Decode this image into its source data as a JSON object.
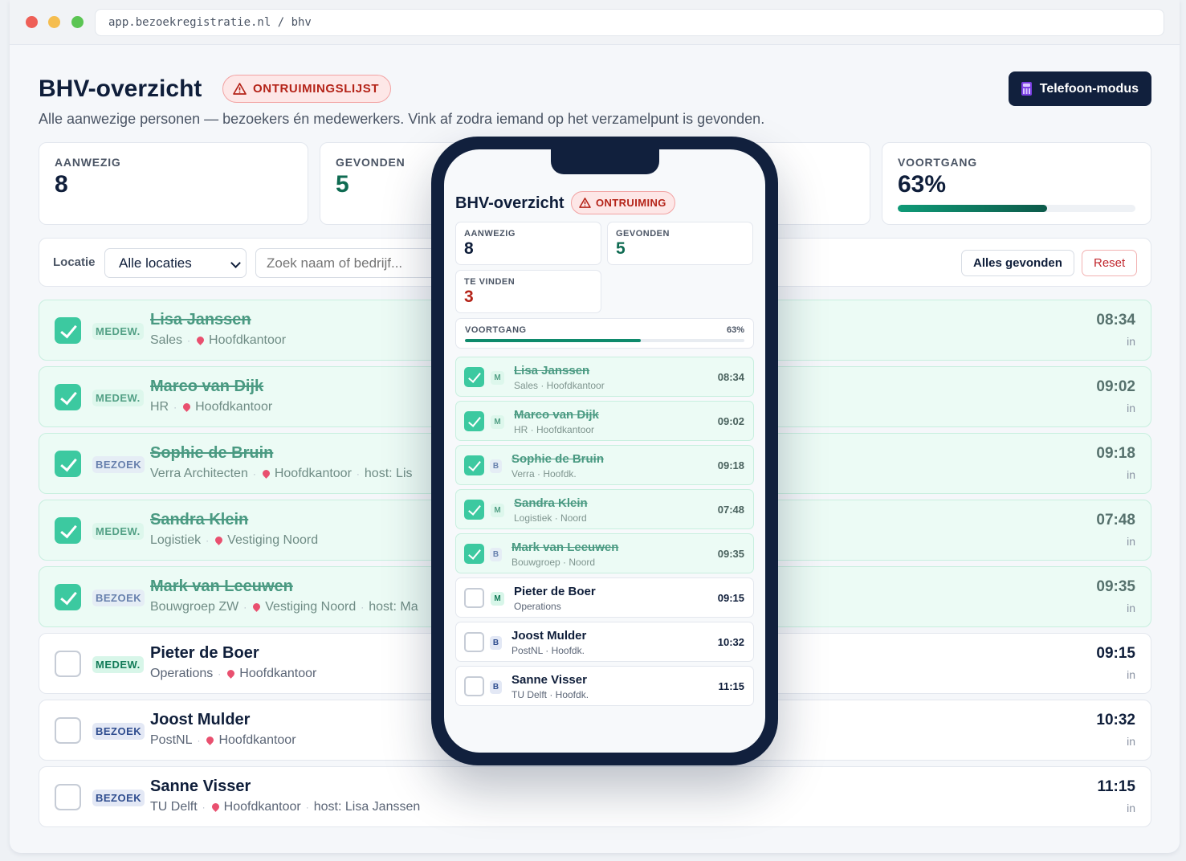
{
  "browser": {
    "url": "app.bezoekregistratie.nl / bhv"
  },
  "header": {
    "title": "BHV-overzicht",
    "badge": "ONTRUIMINGSLIJST",
    "subtitle": "Alle aanwezige personen — bezoekers én medewerkers. Vink af zodra iemand op het verzamelpunt is gevonden.",
    "phone_mode_label": "Telefoon-modus"
  },
  "stats": {
    "present_label": "AANWEZIG",
    "present_value": "8",
    "found_label": "GEVONDEN",
    "found_value": "5",
    "progress_label": "VOORTGANG",
    "progress_value": "63%",
    "progress_fraction": 0.63
  },
  "filters": {
    "location_label": "Locatie",
    "location_selected": "Alle locaties",
    "search_placeholder": "Zoek naam of bedrijf...",
    "all_found_label": "Alles gevonden",
    "reset_label": "Reset"
  },
  "people": [
    {
      "name": "Lisa Janssen",
      "type": "MEDEW.",
      "org": "Sales",
      "location": "Hoofdkantoor",
      "host": "",
      "time": "08:34",
      "dir": "in",
      "found": true
    },
    {
      "name": "Marco van Dijk",
      "type": "MEDEW.",
      "org": "HR",
      "location": "Hoofdkantoor",
      "host": "",
      "time": "09:02",
      "dir": "in",
      "found": true
    },
    {
      "name": "Sophie de Bruin",
      "type": "BEZOEK",
      "org": "Verra Architecten",
      "location": "Hoofdkantoor",
      "host": "host: Lis",
      "time": "09:18",
      "dir": "in",
      "found": true
    },
    {
      "name": "Sandra Klein",
      "type": "MEDEW.",
      "org": "Logistiek",
      "location": "Vestiging Noord",
      "host": "",
      "time": "07:48",
      "dir": "in",
      "found": true
    },
    {
      "name": "Mark van Leeuwen",
      "type": "BEZOEK",
      "org": "Bouwgroep ZW",
      "location": "Vestiging Noord",
      "host": "host: Ma",
      "time": "09:35",
      "dir": "in",
      "found": true
    },
    {
      "name": "Pieter de Boer",
      "type": "MEDEW.",
      "org": "Operations",
      "location": "Hoofdkantoor",
      "host": "",
      "time": "09:15",
      "dir": "in",
      "found": false
    },
    {
      "name": "Joost Mulder",
      "type": "BEZOEK",
      "org": "PostNL",
      "location": "Hoofdkantoor",
      "host": "",
      "time": "10:32",
      "dir": "in",
      "found": false
    },
    {
      "name": "Sanne Visser",
      "type": "BEZOEK",
      "org": "TU Delft",
      "location": "Hoofdkantoor",
      "host": "host: Lisa Janssen",
      "time": "11:15",
      "dir": "in",
      "found": false
    }
  ],
  "phone": {
    "title": "BHV-overzicht",
    "badge": "ONTRUIMING",
    "present_label": "AANWEZIG",
    "present_value": "8",
    "found_label": "GEVONDEN",
    "found_value": "5",
    "tofind_label": "TE VINDEN",
    "tofind_value": "3",
    "progress_label": "VOORTGANG",
    "progress_value": "63%",
    "progress_fraction": 0.63,
    "rows": [
      {
        "tag": "M",
        "name": "Lisa Janssen",
        "meta": "Sales · Hoofdkantoor",
        "time": "08:34",
        "found": true
      },
      {
        "tag": "M",
        "name": "Marco van Dijk",
        "meta": "HR · Hoofdkantoor",
        "time": "09:02",
        "found": true
      },
      {
        "tag": "B",
        "name": "Sophie de Bruin",
        "meta": "Verra · Hoofdk.",
        "time": "09:18",
        "found": true
      },
      {
        "tag": "M",
        "name": "Sandra Klein",
        "meta": "Logistiek · Noord",
        "time": "07:48",
        "found": true
      },
      {
        "tag": "B",
        "name": "Mark van Leeuwen",
        "meta": "Bouwgroep · Noord",
        "time": "09:35",
        "found": true
      },
      {
        "tag": "M",
        "name": "Pieter de Boer",
        "meta": "Operations",
        "time": "09:15",
        "found": false
      },
      {
        "tag": "B",
        "name": "Joost Mulder",
        "meta": "PostNL · Hoofdk.",
        "time": "10:32",
        "found": false
      },
      {
        "tag": "B",
        "name": "Sanne Visser",
        "meta": "TU Delft · Hoofdk.",
        "time": "11:15",
        "found": false
      }
    ]
  },
  "colors": {
    "navy": "#11203d",
    "danger": "#b42318",
    "success": "#0f8a6c",
    "found_row": "#ecfbf5"
  }
}
